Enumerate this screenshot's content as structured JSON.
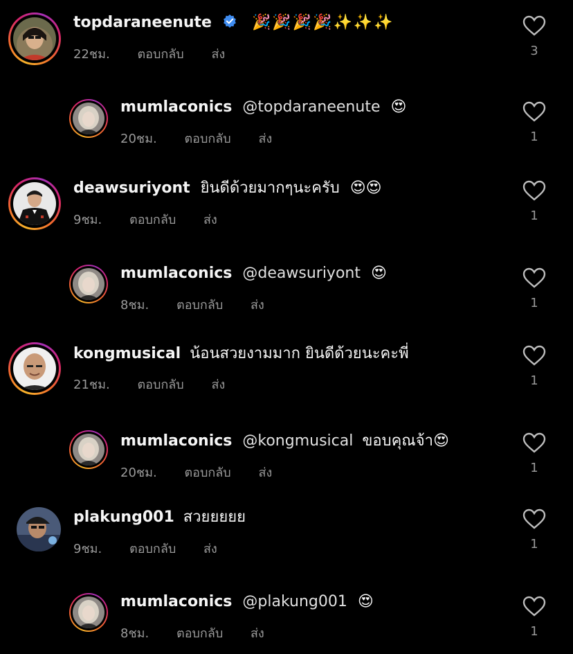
{
  "comments": [
    {
      "username": "topdaraneenute",
      "verified": true,
      "text": "",
      "mention": "",
      "emoji": "🎉🎉🎉🎉✨✨✨",
      "time": "22ชม.",
      "reply": "ตอบกลับ",
      "send": "ส่ง",
      "likes": "3",
      "avatar": "woman-photo"
    },
    {
      "username": "mumlaconics",
      "verified": false,
      "text": "",
      "mention": "@topdaraneenute",
      "emoji": "😍",
      "time": "20ชม.",
      "reply": "ตอบกลับ",
      "send": "ส่ง",
      "likes": "1",
      "avatar": "blonde-photo"
    },
    {
      "username": "deawsuriyont",
      "verified": false,
      "text": "ยินดีด้วยมากๆนะครับ",
      "mention": "",
      "emoji": "😍😍",
      "time": "9ชม.",
      "reply": "ตอบกลับ",
      "send": "ส่ง",
      "likes": "1",
      "avatar": "man-suit-photo"
    },
    {
      "username": "mumlaconics",
      "verified": false,
      "text": "",
      "mention": "@deawsuriyont",
      "emoji": "😍",
      "time": "8ชม.",
      "reply": "ตอบกลับ",
      "send": "ส่ง",
      "likes": "1",
      "avatar": "blonde-photo"
    },
    {
      "username": "kongmusical",
      "verified": false,
      "text": "น้อนสวยงามมาก ยินดีด้วยนะคะพี่",
      "mention": "",
      "emoji": "",
      "time": "21ชม.",
      "reply": "ตอบกลับ",
      "send": "ส่ง",
      "likes": "1",
      "avatar": "bald-man-photo"
    },
    {
      "username": "mumlaconics",
      "verified": false,
      "text": "",
      "mention": "@kongmusical",
      "mention_text": "ขอบคุณจ้า",
      "emoji": "😍",
      "time": "20ชม.",
      "reply": "ตอบกลับ",
      "send": "ส่ง",
      "likes": "1",
      "avatar": "blonde-photo"
    },
    {
      "username": "plakung001",
      "verified": false,
      "text": "สวยยยยย",
      "mention": "",
      "emoji": "",
      "time": "9ชม.",
      "reply": "ตอบกลับ",
      "send": "ส่ง",
      "likes": "1",
      "avatar": "man-cap-photo"
    },
    {
      "username": "mumlaconics",
      "verified": false,
      "text": "",
      "mention": "@plakung001",
      "emoji": "😍",
      "time": "8ชม.",
      "reply": "ตอบกลับ",
      "send": "ส่ง",
      "likes": "1",
      "avatar": "blonde-photo"
    }
  ]
}
